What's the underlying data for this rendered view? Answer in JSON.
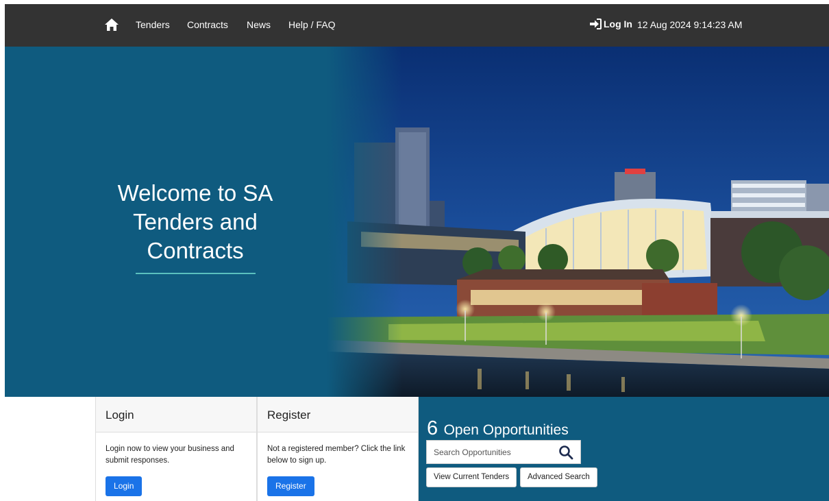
{
  "nav": {
    "links": [
      "Tenders",
      "Contracts",
      "News",
      "Help / FAQ"
    ],
    "login_label": "Log In",
    "datetime": "12 Aug 2024 9:14:23 AM"
  },
  "hero": {
    "welcome_lines": [
      "Welcome to SA",
      "Tenders and",
      "Contracts"
    ]
  },
  "login_card": {
    "title": "Login",
    "text": "Login now to view your business and submit responses.",
    "button": "Login"
  },
  "register_card": {
    "title": "Register",
    "text": "Not a registered member? Click the link below to sign up.",
    "button": "Register"
  },
  "opportunities": {
    "count": "6",
    "label": "Open Opportunities",
    "search_placeholder": "Search Opportunities",
    "buttons": [
      "View Current Tenders",
      "Advanced Search"
    ]
  },
  "colors": {
    "nav_bg": "#333333",
    "brand_blue": "#0f5b7f",
    "button_blue": "#1a73e8",
    "accent_teal": "#5bc0be"
  }
}
